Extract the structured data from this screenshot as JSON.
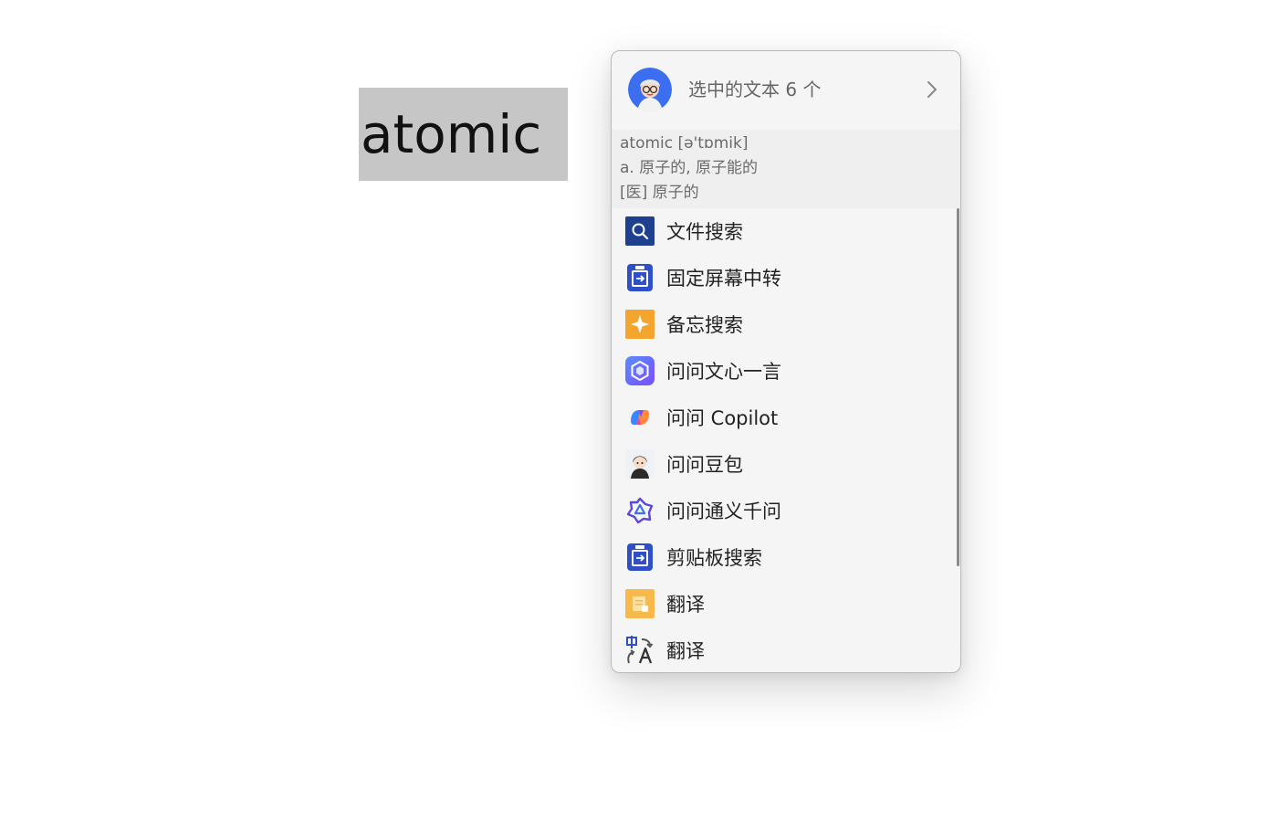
{
  "selection": {
    "word": "atomic"
  },
  "popup": {
    "header": {
      "title": "选中的文本 6 个",
      "avatar_icon": "user-avatar-icon",
      "chevron_icon": "chevron-right-icon"
    },
    "dictionary": {
      "headword_line": "atomic [ə'tɒmik]",
      "definition_1": "a. 原子的, 原子能的",
      "definition_2": "[医] 原子的"
    },
    "menu": [
      {
        "label": "文件搜索",
        "icon": "file-search-icon"
      },
      {
        "label": "固定屏幕中转",
        "icon": "clipboard-icon"
      },
      {
        "label": "备忘搜索",
        "icon": "memo-star-icon"
      },
      {
        "label": "问问文心一言",
        "icon": "wenxin-icon"
      },
      {
        "label": "问问 Copilot",
        "icon": "copilot-icon"
      },
      {
        "label": "问问豆包",
        "icon": "doubao-icon"
      },
      {
        "label": "问问通义千问",
        "icon": "tongyi-icon"
      },
      {
        "label": "剪贴板搜索",
        "icon": "clipboard-icon"
      },
      {
        "label": "翻译",
        "icon": "translate-doc-icon"
      },
      {
        "label": "翻译",
        "icon": "translate-icon"
      }
    ]
  },
  "colors": {
    "selection_bg": "#c6c6c6",
    "popup_bg": "#f5f5f5",
    "dict_bg": "#efefef",
    "accent_blue": "#2f4fc6",
    "accent_orange": "#f4a52e"
  }
}
